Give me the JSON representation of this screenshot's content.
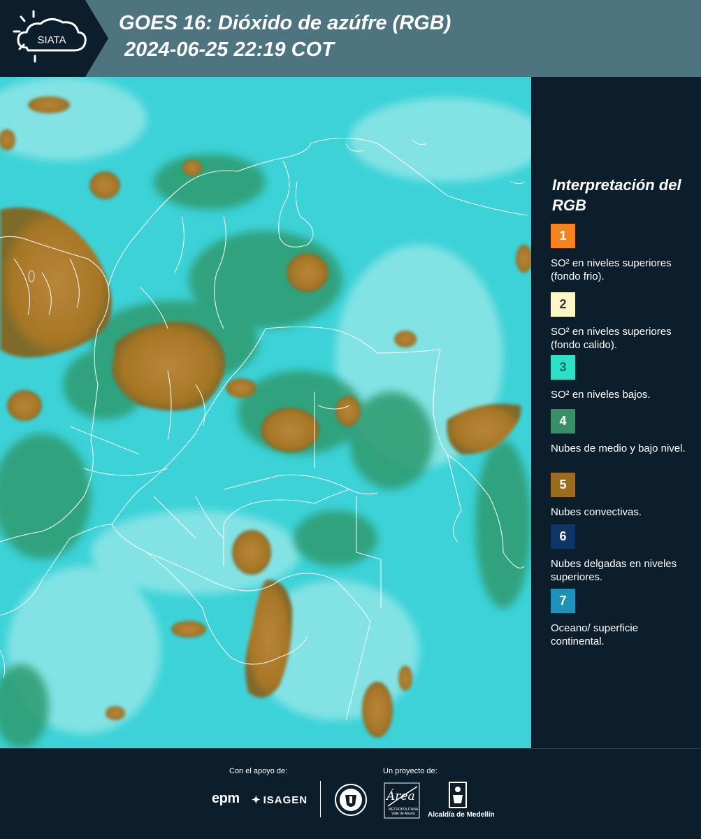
{
  "header": {
    "logo_text": "SIATA",
    "title_line1": "GOES 16: Dióxido de azúfre (RGB)",
    "title_line2": " 2024-06-25 22:19 COT"
  },
  "legend": {
    "title": "Interpretación del RGB",
    "items": [
      {
        "number": "1",
        "color": "#f5841f",
        "label": "SO² en niveles superiores (fondo frio)."
      },
      {
        "number": "2",
        "color": "#fdf6c6",
        "label": "SO² en niveles superiores (fondo calido)."
      },
      {
        "number": "3",
        "color": "#2de1c6",
        "label": "SO² en niveles bajos."
      },
      {
        "number": "4",
        "color": "#3a8f66",
        "label": "Nubes de medio y bajo nivel."
      },
      {
        "number": "5",
        "color": "#9a6c1e",
        "label": "Nubes convectivas."
      },
      {
        "number": "6",
        "color": "#0f3566",
        "label": "Nubes delgadas en niveles superiores."
      },
      {
        "number": "7",
        "color": "#1e92b8",
        "label": "Oceano/ superficie continental."
      }
    ]
  },
  "footer": {
    "support_label": "Con el apoyo de:",
    "project_label": "Un proyecto de:",
    "sponsor_1": "epm",
    "sponsor_2": "ISAGEN",
    "partner_1": "Área",
    "partner_1_sub": "METROPOLITANA Valle de Aburrá",
    "partner_2": "Alcaldía de Medellín"
  },
  "colors": {
    "header_bg": "#4e7480",
    "panel_bg": "#0c1e2b",
    "map_base": "#3bd1d6",
    "convective": "#a97928",
    "mid_low": "#2e9a70"
  }
}
